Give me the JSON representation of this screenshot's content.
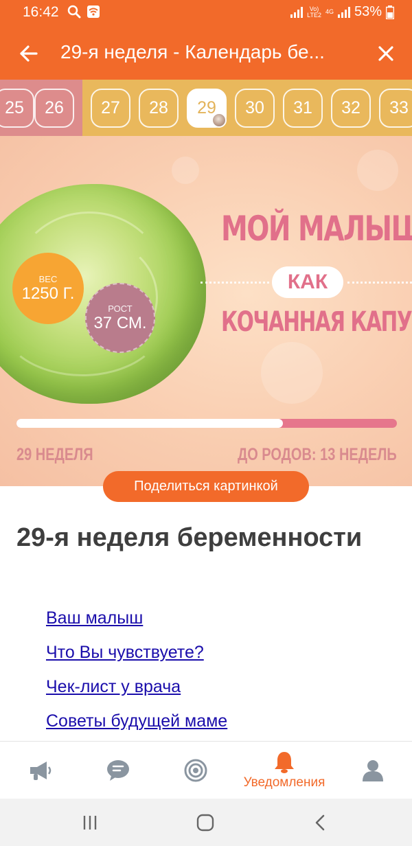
{
  "status_bar": {
    "time": "16:42",
    "network_top": "Vo)",
    "network_bottom": "LTE2",
    "network_gen": "4G",
    "battery_text": "53%"
  },
  "app_bar": {
    "title": "29-я неделя - Календарь бе...",
    "back_icon": "arrow-left-icon",
    "close_icon": "close-icon"
  },
  "weeks": {
    "items": [
      "25",
      "26",
      "27",
      "28",
      "29",
      "30",
      "31",
      "32",
      "33"
    ],
    "active": "29"
  },
  "hero": {
    "title_line1": "МОЙ МАЛЫШ",
    "connector": "КАК",
    "title_line2": "КОЧАННАЯ КАПУСТА",
    "weight_label": "ВЕС",
    "weight_value": "1250 Г.",
    "height_label": "РОСТ",
    "height_value": "37 СМ.",
    "week_label": "29 НЕДЕЛЯ",
    "until_label": "ДО РОДОВ: 13 НЕДЕЛЬ",
    "progress_fraction": 0.7
  },
  "share_button": "Поделиться картинкой",
  "page_heading": "29-я неделя беременности",
  "toc": [
    "Ваш малыш",
    "Что Вы чувствуете?",
    "Чек-лист у врача",
    "Советы будущей маме"
  ],
  "bottom_nav": [
    {
      "icon": "megaphone-icon",
      "label": ""
    },
    {
      "icon": "chat-icon",
      "label": ""
    },
    {
      "icon": "target-icon",
      "label": ""
    },
    {
      "icon": "bell-icon",
      "label": "Уведомления"
    },
    {
      "icon": "person-icon",
      "label": ""
    }
  ],
  "colors": {
    "accent": "#f26a2a",
    "week_strip": "#e9b85c",
    "week_strip_past": "#dd8c8c",
    "hero_pink": "#e1708a",
    "link": "#1a0dab"
  }
}
